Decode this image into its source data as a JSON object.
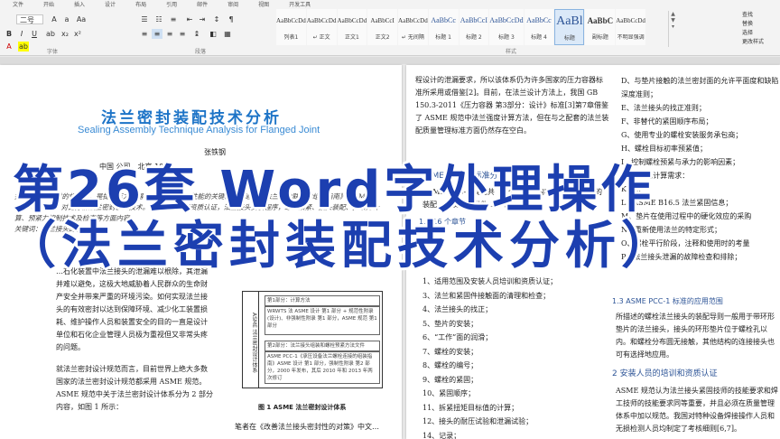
{
  "ribbon": {
    "tabs": [
      "文件",
      "开始",
      "插入",
      "设计",
      "布局",
      "引用",
      "邮件",
      "审阅",
      "视图",
      "开发工具"
    ],
    "font_size_value": "二号",
    "group_labels": {
      "font": "字体",
      "paragraph": "段落",
      "styles": "样式"
    },
    "styles": [
      {
        "sample": "AaBbCcDd",
        "name": "列表1"
      },
      {
        "sample": "AaBbCcDd",
        "name": "↵ 正文"
      },
      {
        "sample": "AaBbCcDd",
        "name": "正文1"
      },
      {
        "sample": "AaBbCcI",
        "name": "正文2"
      },
      {
        "sample": "AaBbCcDd",
        "name": "↵ 无间隔"
      },
      {
        "sample": "AaBbCc",
        "name": "标题 1"
      },
      {
        "sample": "AaBbCcI",
        "name": "标题 2"
      },
      {
        "sample": "AaBbCcDd",
        "name": "标题 3"
      },
      {
        "sample": "AaBbCc",
        "name": "标题 4"
      },
      {
        "sample": "AaBl",
        "name": "标题"
      },
      {
        "sample": "AaBbC",
        "name": "副标题"
      },
      {
        "sample": "AaBbCcDd",
        "name": "不明显强调"
      }
    ],
    "right_commands": [
      "查找",
      "替换",
      "选择",
      "更改样式"
    ]
  },
  "left_page": {
    "title_cn": "法兰密封装配技术分析",
    "title_en": "Sealing Assembly Technique Analysis for Flanged Joint",
    "author": "张铁钢",
    "org": "中国                        公司，北京 1001",
    "abstract": "摘要：法兰密封的规范化，是提高压力容器、管道法兰密封性能的关键。本文通过《法兰螺栓联接的组装指南》(ASME PCC-1) 标准，对比分析法兰密封装配技术。人员的培训和资质认证，法兰接头安装程序，螺栓预紧、接头装配、预紧力计算、预紧力控制技术及检查等方面内容。",
    "keywords": "关键词：法兰接头的装配；",
    "para1": "…石化装置中法兰接头的泄漏难以根除，其泄漏并难以避免，这极大地威胁着人民群众的生命财产安全并带来严重的环境污染。如何实现法兰接头的有效密封以达到保障环境、减少化工装置损耗、维护操作人员和装置安全的目的一直是设计单位和石化企业管理人员极为重视但又非常头疼的问题。",
    "para2": "就法兰密封设计规范而言，目前世界上绝大多数国家的法兰密封设计规范都采用 ASME 规范。ASME 规范中关于法兰密封设计体系分为 2 部分内容，如图 1 所示：",
    "figure_side": "ASME 法兰密封设计体系",
    "figure_rows": [
      "第1部分：计算方法",
      "WRWTS 法 ASME 设计 第1 部分 + 规范性附录(设计)、非强制性附录 第1 部分，ASME 规范 第1 部分",
      "第2部分：法兰接头组装和螺栓预紧方法文件",
      "ASME PCC-1《承压设备法兰螺栓连接的组装指南》ASME 设计 第1 部分，强制性附录 第2 部分，2000 年发布，其后 2010 年和 2013 年两次修订"
    ],
    "figure_caption": "图 1   ASME 法兰密封设计体系",
    "para3": "笔者在《改善法兰接头密封性的对策》中文…"
  },
  "right_page": {
    "para_top": "程设计的泄漏要求，所以该体系仍为许多国家的压力容器标准所采用或借鉴[2]。目前，在法兰设计方法上，我国 GB 150.3-2011《压力容器 第3部分：设计》标准[3]第7章借鉴了 ASME 规范中法兰强度计算方法，但在与之配套的法兰装配质量管理标准方面仍然存在空白。",
    "heading1": "1  ASME PCC-1 标准分析",
    "para_h1": "ASME PCC-1 规范共 13 个章节，内容涵盖法兰接头的装配，以及标准附件 16 个附录。",
    "sub1": "1.1   16 个章节",
    "list": [
      "1、适用范围及安装人员培训和资质认证；",
      "3、法兰和紧固件接触面的清理和检查；",
      "4、法兰接头的找正；",
      "5、垫片的安装；",
      "6、“工作”面的润滑；",
      "7、螺栓的安装；",
      "8、螺栓的编号；",
      "9、螺栓的紧固；",
      "10、紧固顺序；",
      "11、拆紧扭矩目标值的计算；",
      "12、接头的耐压试验和泄漏试验；",
      "14、记录；"
    ],
    "list2": [
      "D、与垫片接触的法兰密封面的允许平面度和缺陷深度准则；",
      "E、法兰接头的找正准则；",
      "F、非替代的紧固顺序布局；",
      "G、使用专业的螺栓安装服务承包商；",
      "H、螺栓目标初率预紧值；",
      "I、控制螺栓预紧与承力的影响因素；",
      "J、所选的计算需求：",
      "K、…",
      "L、ASME B16.5 法兰紧固信息；",
      "M、垫片在使用过程中的硬化效应的采购",
      "N、重新使用法兰的特定形式；",
      "O、螺栓平行阶段，注释和使用时的考量",
      "P、法兰接头泄漏的故障检查和排除；"
    ],
    "sub2": "1.3   ASME PCC-1 标准的应用范围",
    "para_sub2": "所描述的螺栓法兰接头的装配导则一般用于带环形垫片的法兰接头，接头的环形垫片位于螺栓孔以内。和螺栓分布圆无接触，其他结构的连接接头也可有选择地应用。",
    "heading2": "2   安装人员的培训和资质认证",
    "para_h2": "ASME 规范认为法兰接头紧固技师的技能要求和焊工技师的技能要求同等重要，并且必须在质量管理体系中加以规范。我国对特种设备焊接操作人员和无损检测人员均制定了考核细则[6,7]。"
  },
  "banner": {
    "line1": "第26套 Word字处理操作",
    "line2": "（法兰密封装配技术分析）"
  }
}
